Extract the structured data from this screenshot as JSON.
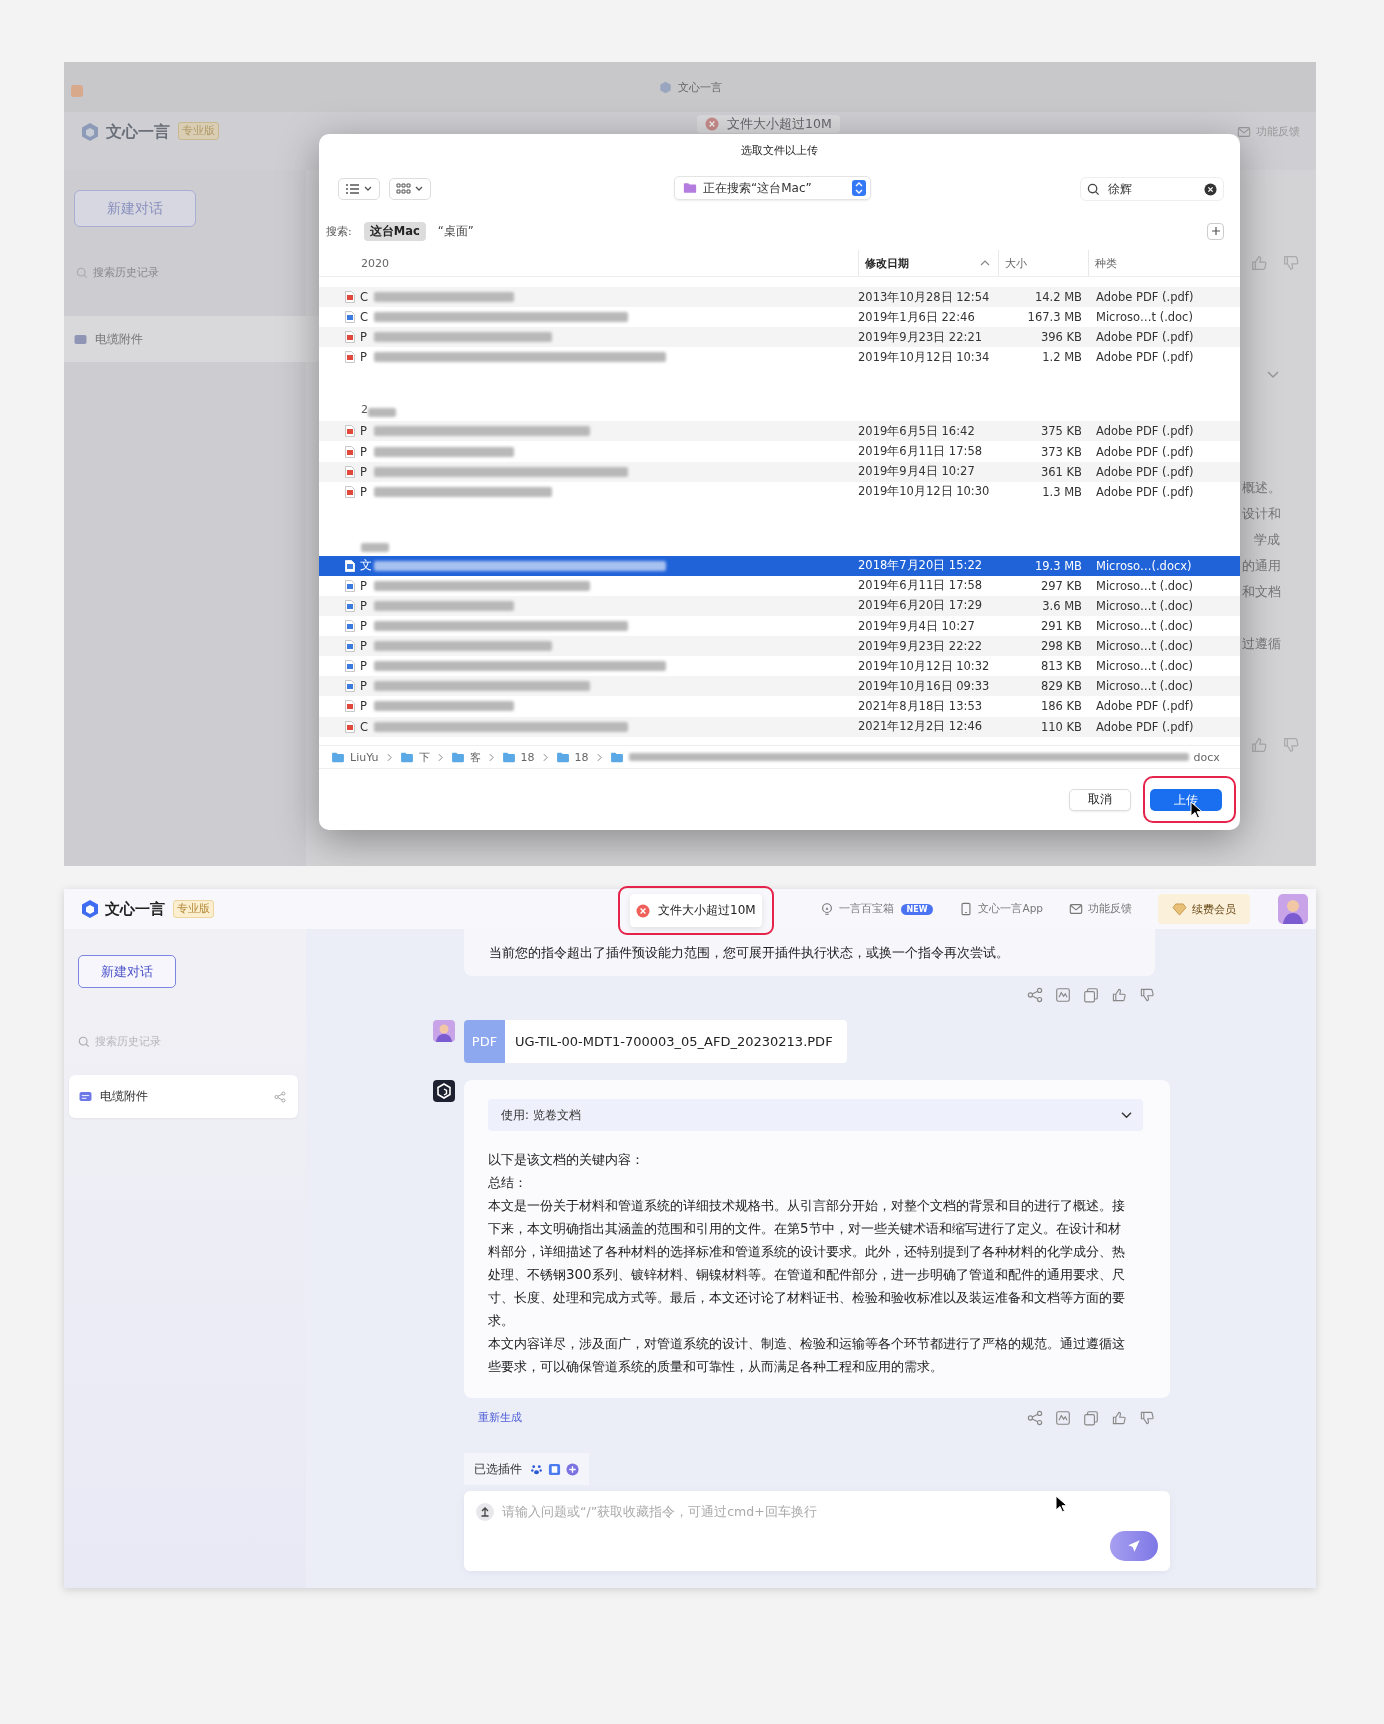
{
  "top_screen": {
    "window_title": "文心一言",
    "logo": "文心一言",
    "edition": "专业版",
    "toast": "文件大小超过10M",
    "header_link": "功能反馈",
    "new_chat": "新建对话",
    "search_placeholder": "搜索历史记录",
    "history": [
      {
        "label": "电缆附件",
        "selected": true
      }
    ],
    "peek_lines": [
      "概述。",
      "设计和",
      "学成",
      "的通用",
      "和文档",
      "过遵循"
    ],
    "dialog": {
      "title": "选取文件以上传",
      "location": "正在搜索“这台Mac”",
      "search_value": "徐辉",
      "scope_label": "搜索:",
      "scopes": [
        {
          "label": "这台Mac",
          "selected": true
        },
        {
          "label": "“桌面”",
          "selected": false
        }
      ],
      "columns": [
        {
          "label": "修改日期",
          "sorted": true
        },
        {
          "label": "大小",
          "sorted": false
        },
        {
          "label": "种类",
          "sorted": false
        }
      ],
      "groups": [
        {
          "label": "2020",
          "rows": [
            {
              "kind": "pdf",
              "name_start": "C",
              "date": "2013年10月28日 12:54",
              "size": "14.2 MB",
              "type_label": "Adobe PDF (.pdf)",
              "selected": false
            },
            {
              "kind": "doc",
              "name_start": "C",
              "date": "2019年1月6日 22:46",
              "size": "167.3 MB",
              "type_label": "Microso…t (.doc)",
              "selected": false
            },
            {
              "kind": "pdf",
              "name_start": "P",
              "date": "2019年9月23日 22:21",
              "size": "396 KB",
              "type_label": "Adobe PDF (.pdf)",
              "selected": false
            },
            {
              "kind": "pdf",
              "name_start": "P",
              "date": "2019年10月12日 10:34",
              "size": "1.2 MB",
              "type_label": "Adobe PDF (.pdf)",
              "selected": false
            }
          ]
        },
        {
          "label": "2",
          "rows": [
            {
              "kind": "pdf",
              "name_start": "P",
              "date": "2019年6月5日 16:42",
              "size": "375 KB",
              "type_label": "Adobe PDF (.pdf)",
              "selected": false
            },
            {
              "kind": "pdf",
              "name_start": "P",
              "date": "2019年6月11日 17:58",
              "size": "373 KB",
              "type_label": "Adobe PDF (.pdf)",
              "selected": false
            },
            {
              "kind": "pdf",
              "name_start": "P",
              "date": "2019年9月4日 10:27",
              "size": "361 KB",
              "type_label": "Adobe PDF (.pdf)",
              "selected": false
            },
            {
              "kind": "pdf",
              "name_start": "P",
              "date": "2019年10月12日 10:30",
              "size": "1.3 MB",
              "type_label": "Adobe PDF (.pdf)",
              "selected": false
            }
          ]
        },
        {
          "rows": [
            {
              "kind": "doc",
              "name_start": "文",
              "date": "2018年7月20日 15:22",
              "size": "19.3 MB",
              "type_label": "Microso…(.docx)",
              "selected": true
            },
            {
              "kind": "doc",
              "name_start": "P",
              "date": "2019年6月11日 17:58",
              "size": "297 KB",
              "type_label": "Microso…t (.doc)",
              "selected": false
            },
            {
              "kind": "doc",
              "name_start": "P",
              "date": "2019年6月20日 17:29",
              "size": "3.6 MB",
              "type_label": "Microso…t (.doc)",
              "selected": false
            },
            {
              "kind": "doc",
              "name_start": "P",
              "date": "2019年9月4日 10:27",
              "size": "291 KB",
              "type_label": "Microso…t (.doc)",
              "selected": false
            },
            {
              "kind": "doc",
              "name_start": "P",
              "date": "2019年9月23日 22:22",
              "size": "298 KB",
              "type_label": "Microso…t (.doc)",
              "selected": false
            },
            {
              "kind": "doc",
              "name_start": "P",
              "date": "2019年10月12日 10:32",
              "size": "813 KB",
              "type_label": "Microso…t (.doc)",
              "selected": false
            },
            {
              "kind": "doc",
              "name_start": "P",
              "date": "2019年10月16日 09:33",
              "size": "829 KB",
              "type_label": "Microso…t (.doc)",
              "selected": false
            },
            {
              "kind": "pdf",
              "name_start": "P",
              "date": "2021年8月18日 13:53",
              "size": "186 KB",
              "type_label": "Adobe PDF (.pdf)",
              "selected": false
            },
            {
              "kind": "pdf",
              "name_start": "C",
              "date": "2021年12月2日 12:46",
              "size": "110 KB",
              "type_label": "Adobe PDF (.pdf)",
              "selected": false
            }
          ]
        }
      ],
      "path": [
        {
          "kind": "folder",
          "label": "LiuYu"
        },
        {
          "kind": "folder",
          "label": "下"
        },
        {
          "kind": "folder",
          "label": "客"
        },
        {
          "kind": "folder",
          "label": "18"
        },
        {
          "kind": "folder",
          "label": "18"
        },
        {
          "kind": "file",
          "label": "docx"
        }
      ],
      "cancel": "取消",
      "confirm": "上传"
    }
  },
  "bottom_screen": {
    "logo": "文心一言",
    "edition": "专业版",
    "toast": "文件大小超过10M",
    "header_links": [
      {
        "kind": "treasure",
        "label": "一言百宝箱",
        "badge": "NEW"
      },
      {
        "kind": "phone",
        "label": "文心一言App"
      },
      {
        "kind": "mail",
        "label": "功能反馈"
      }
    ],
    "member_button": "续费会员",
    "new_chat": "新建对话",
    "search_placeholder": "搜索历史记录",
    "history": [
      {
        "label": "电缆附件",
        "selected": true
      }
    ],
    "messages": [
      {
        "kind": "notice",
        "text": "当前您的指令超出了插件预设能力范围，您可展开插件执行状态，或换一个指令再次尝试。"
      },
      {
        "kind": "file",
        "file_type": "PDF",
        "file_name": "UG-TIL-00-MDT1-700003_05_AFD_20230213.PDF"
      },
      {
        "kind": "answer",
        "plugin": "使用: 览卷文档",
        "paragraphs": [
          "以下是该文档的关键内容：",
          "总结：",
          "本文是一份关于材料和管道系统的详细技术规格书。从引言部分开始，对整个文档的背景和目的进行了概述。接下来，本文明确指出其涵盖的范围和引用的文件。在第5节中，对一些关键术语和缩写进行了定义。在设计和材料部分，详细描述了各种材料的选择标准和管道系统的设计要求。此外，还特别提到了各种材料的化学成分、热处理、不锈钢300系列、镀锌材料、铜镍材料等。在管道和配件部分，进一步明确了管道和配件的通用要求、尺寸、长度、处理和完成方式等。最后，本文还讨论了材料证书、检验和验收标准以及装运准备和文档等方面的要求。",
          "本文内容详尽，涉及面广，对管道系统的设计、制造、检验和运输等各个环节都进行了严格的规范。通过遵循这些要求，可以确保管道系统的质量和可靠性，从而满足各种工程和应用的需求。"
        ],
        "regenerate": "重新生成"
      }
    ],
    "selected_plugins_label": "已选插件",
    "input_placeholder": "请输入问题或“/”获取收藏指令，可通过cmd+回车换行"
  }
}
